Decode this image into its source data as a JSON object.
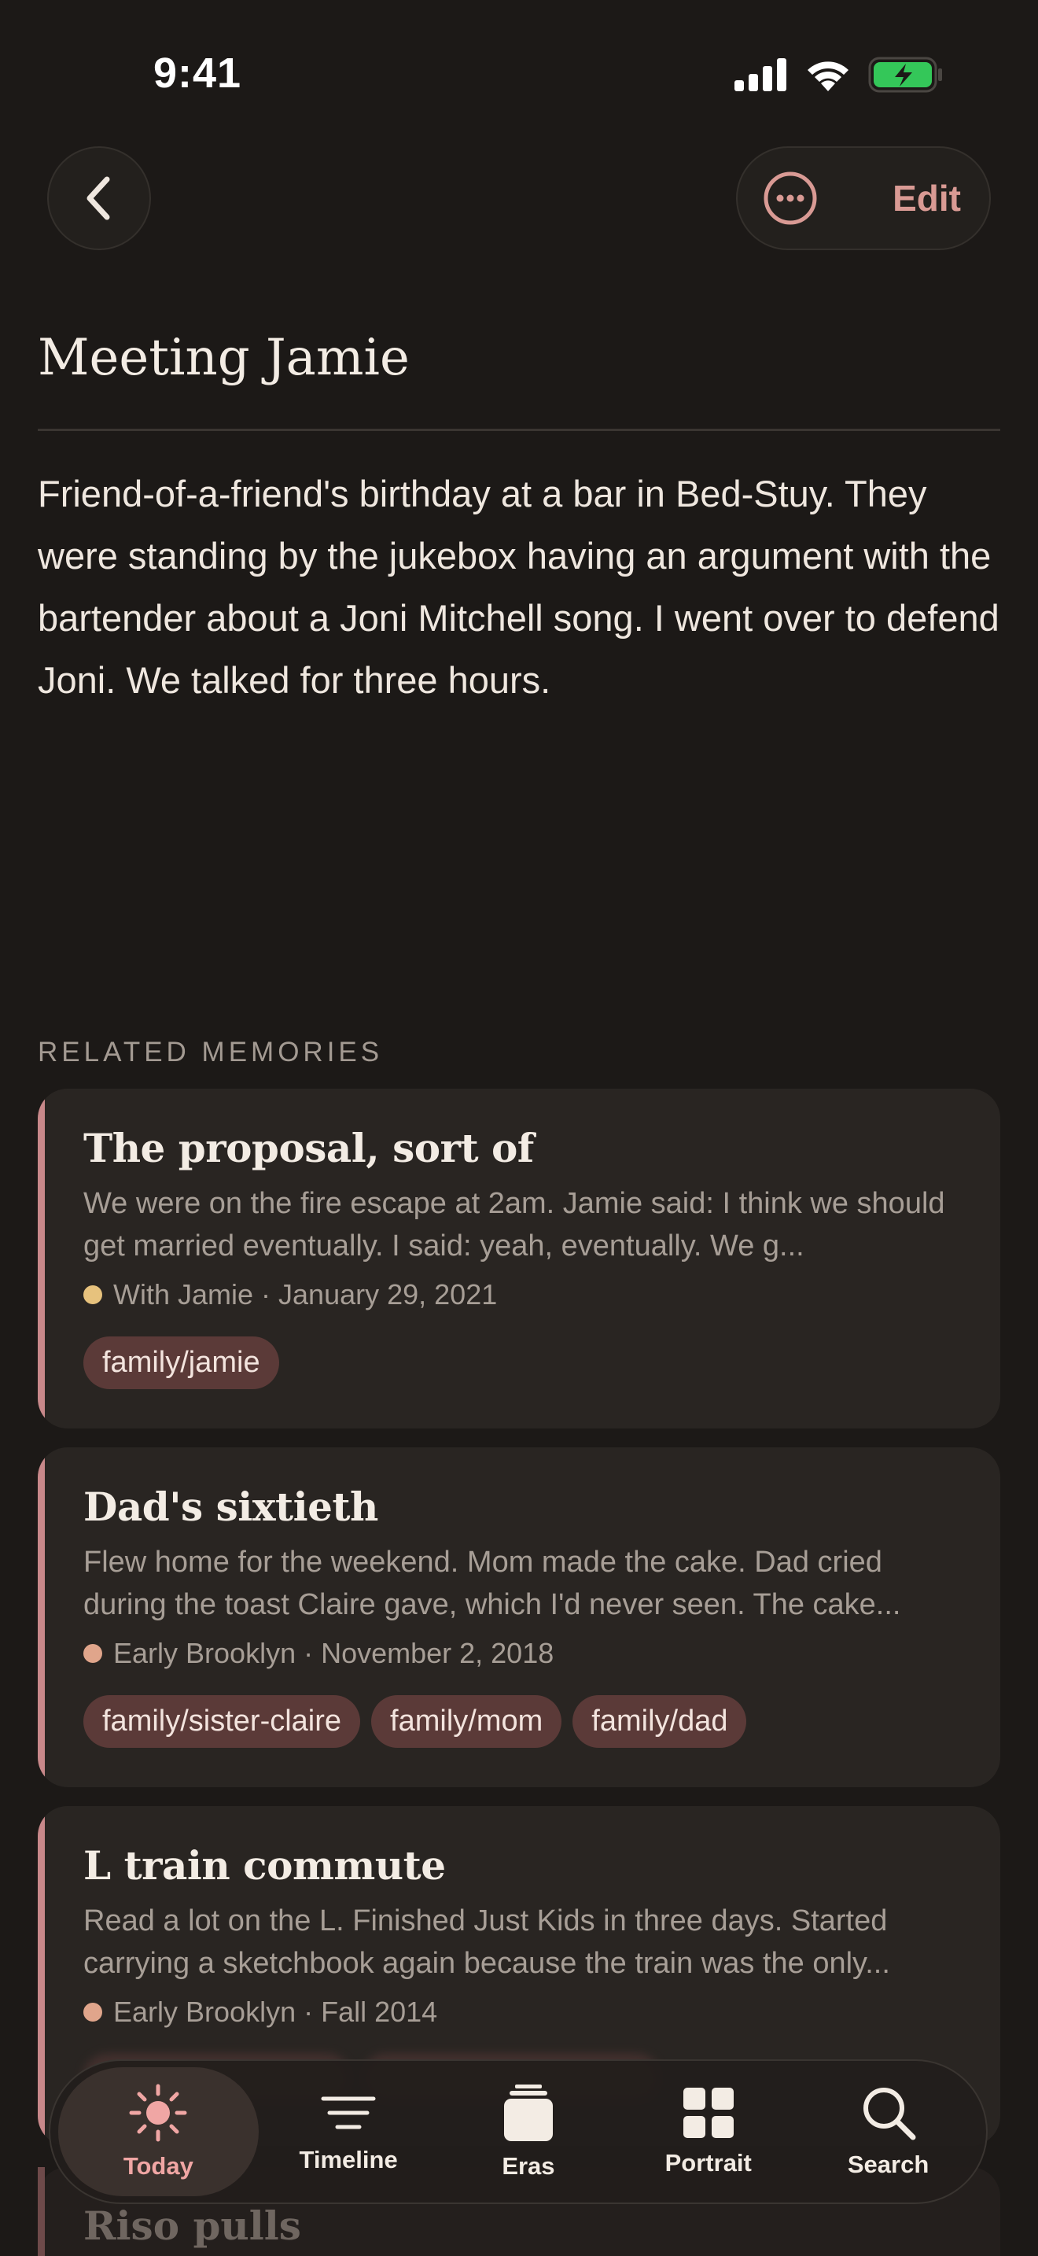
{
  "status_bar": {
    "time": "9:41"
  },
  "nav": {
    "edit_label": "Edit"
  },
  "memory": {
    "title": "Meeting Jamie",
    "body": "Friend-of-a-friend's birthday at a bar in Bed-Stuy. They were standing by the jukebox having an argument with the bartender about a Joni Mitchell song. I went over to defend Joni. We talked for three hours."
  },
  "related": {
    "section_label": "RELATED MEMORIES",
    "cards": [
      {
        "title": "The proposal, sort of",
        "excerpt": "We were on the fire escape at 2am. Jamie said: I think we should get married eventually. I said: yeah, eventually. We g...",
        "meta": "With Jamie · January 29, 2021",
        "dot_color": "#e7c27d",
        "tags": [
          "family/jamie"
        ]
      },
      {
        "title": "Dad's sixtieth",
        "excerpt": "Flew home for the weekend. Mom made the cake. Dad cried during the toast Claire gave, which I'd never seen. The cake...",
        "meta": "Early Brooklyn · November 2, 2018",
        "dot_color": "#e0a58b",
        "tags": [
          "family/sister-claire",
          "family/mom",
          "family/dad"
        ]
      },
      {
        "title": "L train commute",
        "excerpt": "Read a lot on the L. Finished Just Kids in three days. Started carrying a sketchbook again because the train was the only...",
        "meta": "Early Brooklyn · Fall 2014",
        "dot_color": "#e0a58b",
        "tags": []
      }
    ],
    "partial_card_title": "Riso pulls"
  },
  "tab_bar": {
    "tabs": [
      {
        "label": "Today",
        "icon": "sun-icon",
        "active": true
      },
      {
        "label": "Timeline",
        "icon": "timeline-icon",
        "active": false
      },
      {
        "label": "Eras",
        "icon": "eras-icon",
        "active": false
      },
      {
        "label": "Portrait",
        "icon": "portrait-grid-icon",
        "active": false
      },
      {
        "label": "Search",
        "icon": "search-icon",
        "active": false
      }
    ]
  },
  "colors": {
    "background": "#1c1917",
    "accent": "#d99a94",
    "card": "#292522",
    "tag": "#5b3a38"
  }
}
